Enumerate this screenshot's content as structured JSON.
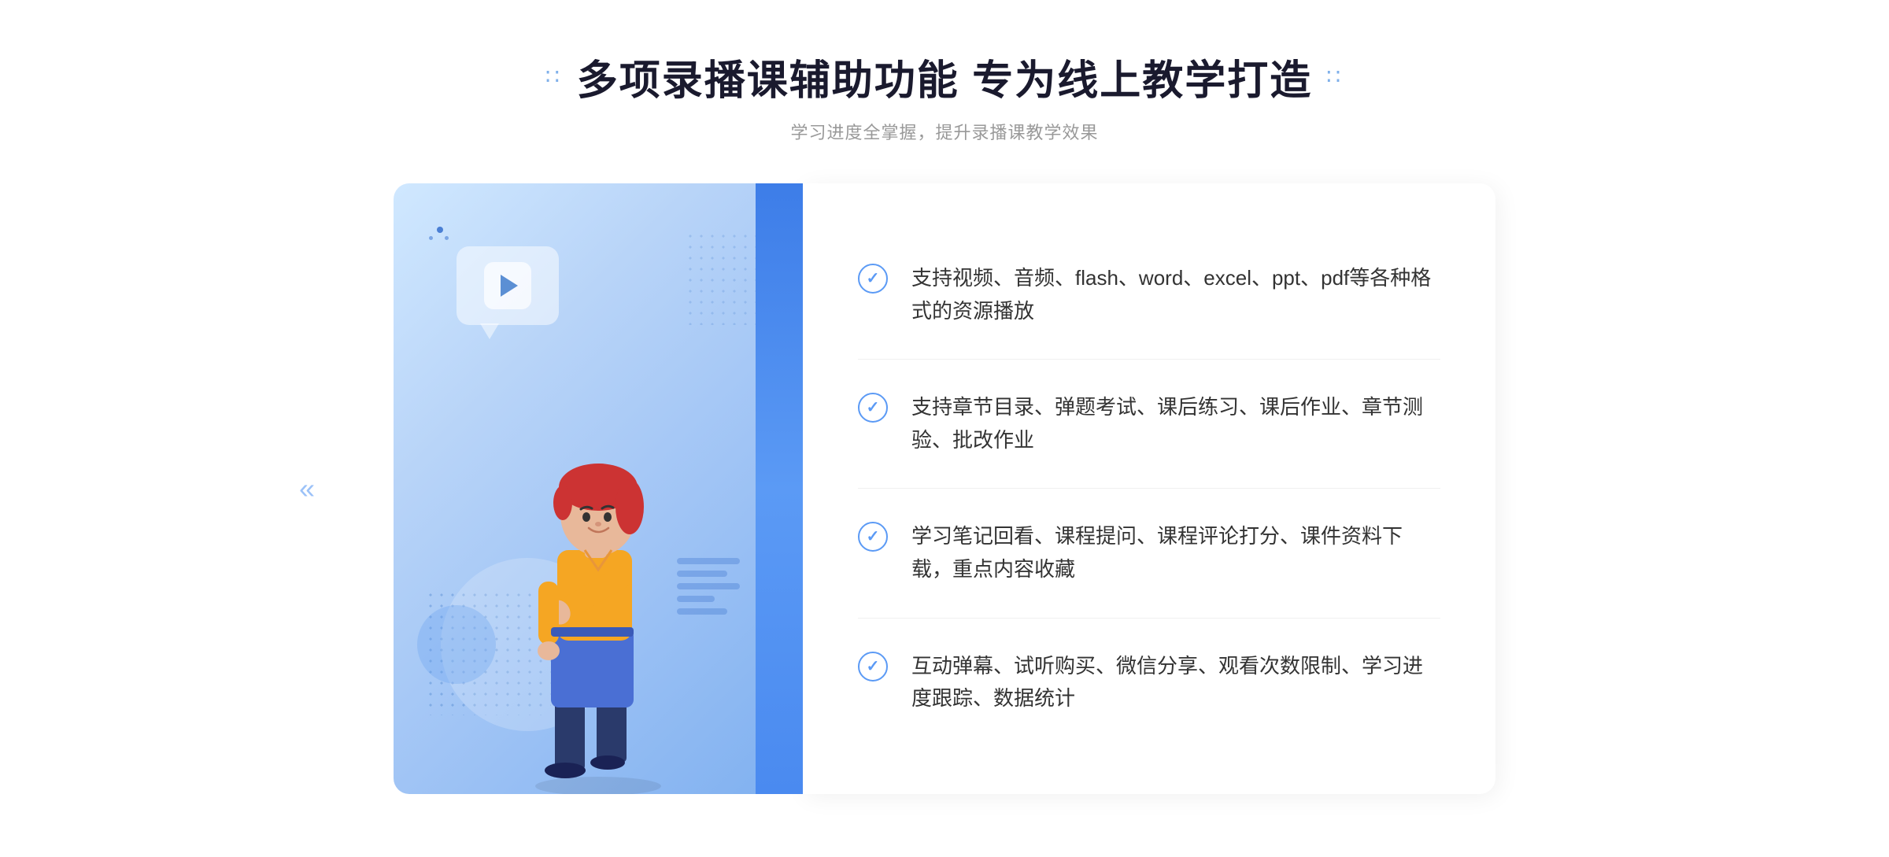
{
  "header": {
    "title_dots_left": "∷",
    "title_dots_right": "∷",
    "main_title": "多项录播课辅助功能 专为线上教学打造",
    "subtitle": "学习进度全掌握，提升录播课教学效果"
  },
  "features": [
    {
      "id": 1,
      "text": "支持视频、音频、flash、word、excel、ppt、pdf等各种格式的资源播放"
    },
    {
      "id": 2,
      "text": "支持章节目录、弹题考试、课后练习、课后作业、章节测验、批改作业"
    },
    {
      "id": 3,
      "text": "学习笔记回看、课程提问、课程评论打分、课件资料下载，重点内容收藏"
    },
    {
      "id": 4,
      "text": "互动弹幕、试听购买、微信分享、观看次数限制、学习进度跟踪、数据统计"
    }
  ],
  "icons": {
    "play": "▶",
    "check": "✓",
    "chevron_left": "«"
  },
  "colors": {
    "accent_blue": "#5b9af5",
    "dark_blue": "#3d7de8",
    "text_dark": "#333333",
    "text_light": "#999999",
    "background": "#ffffff",
    "illustration_bg": "#c8dff8"
  }
}
